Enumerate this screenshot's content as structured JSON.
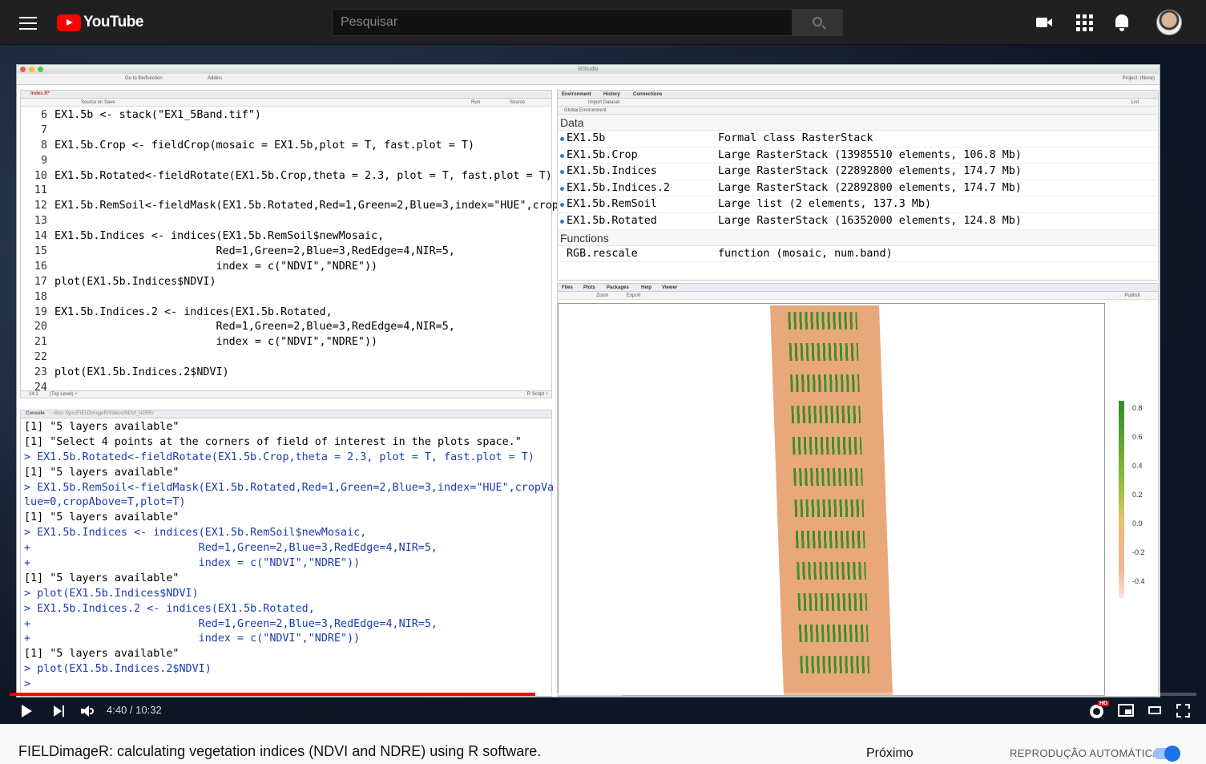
{
  "header": {
    "logo_text": "YouTube",
    "search_placeholder": "Pesquisar"
  },
  "rstudio": {
    "window_title": "RStudio",
    "toolbar": {
      "goto": "Go to file/function",
      "addins": "Addins",
      "project": "Project: (None)"
    },
    "editor": {
      "tab": "Index.R*",
      "source_on_save": "Source on Save",
      "run": "Run",
      "source": "Source",
      "lines": [
        {
          "n": "6",
          "code": "EX1.5b <- stack(\"EX1_5Band.tif\")"
        },
        {
          "n": "7",
          "code": ""
        },
        {
          "n": "8",
          "code": "EX1.5b.Crop <- fieldCrop(mosaic = EX1.5b,plot = T, fast.plot = T)"
        },
        {
          "n": "9",
          "code": ""
        },
        {
          "n": "10",
          "code": "EX1.5b.Rotated<-fieldRotate(EX1.5b.Crop,theta = 2.3, plot = T, fast.plot = T)"
        },
        {
          "n": "11",
          "code": ""
        },
        {
          "n": "12",
          "code": "EX1.5b.RemSoil<-fieldMask(EX1.5b.Rotated,Red=1,Green=2,Blue=3,index=\"HUE\",crop"
        },
        {
          "n": "13",
          "code": ""
        },
        {
          "n": "14",
          "code": "EX1.5b.Indices <- indices(EX1.5b.RemSoil$newMosaic,"
        },
        {
          "n": "15",
          "code": "                         Red=1,Green=2,Blue=3,RedEdge=4,NIR=5,"
        },
        {
          "n": "16",
          "code": "                         index = c(\"NDVI\",\"NDRE\"))"
        },
        {
          "n": "17",
          "code": "plot(EX1.5b.Indices$NDVI)"
        },
        {
          "n": "18",
          "code": ""
        },
        {
          "n": "19",
          "code": "EX1.5b.Indices.2 <- indices(EX1.5b.Rotated,"
        },
        {
          "n": "20",
          "code": "                         Red=1,Green=2,Blue=3,RedEdge=4,NIR=5,"
        },
        {
          "n": "21",
          "code": "                         index = c(\"NDVI\",\"NDRE\"))"
        },
        {
          "n": "22",
          "code": ""
        },
        {
          "n": "23",
          "code": "plot(EX1.5b.Indices.2$NDVI)"
        },
        {
          "n": "24",
          "code": ""
        }
      ],
      "status_pos": "24:1",
      "status_level": "(Top Level) ÷",
      "status_type": "R Script ÷"
    },
    "console": {
      "tab": "Console",
      "path": "~/Box Sync/FIELDimageR/Videos/NDVI_NDRE/",
      "lines": [
        {
          "t": "[1] \"5 layers available\"",
          "cmd": false
        },
        {
          "t": "[1] \"Select 4 points at the corners of field of interest in the plots space.\"",
          "cmd": false
        },
        {
          "t": "> EX1.5b.Rotated<-fieldRotate(EX1.5b.Crop,theta = 2.3, plot = T, fast.plot = T)",
          "cmd": true
        },
        {
          "t": "[1] \"5 layers available\"",
          "cmd": false
        },
        {
          "t": "> EX1.5b.RemSoil<-fieldMask(EX1.5b.Rotated,Red=1,Green=2,Blue=3,index=\"HUE\",cropVa",
          "cmd": true
        },
        {
          "t": "lue=0,cropAbove=T,plot=T)",
          "cmd": true
        },
        {
          "t": "[1] \"5 layers available\"",
          "cmd": false
        },
        {
          "t": "> EX1.5b.Indices <- indices(EX1.5b.RemSoil$newMosaic,",
          "cmd": true
        },
        {
          "t": "+                          Red=1,Green=2,Blue=3,RedEdge=4,NIR=5,",
          "cmd": true
        },
        {
          "t": "+                          index = c(\"NDVI\",\"NDRE\"))",
          "cmd": true
        },
        {
          "t": "[1] \"5 layers available\"",
          "cmd": false
        },
        {
          "t": "> plot(EX1.5b.Indices$NDVI)",
          "cmd": true
        },
        {
          "t": "> EX1.5b.Indices.2 <- indices(EX1.5b.Rotated,",
          "cmd": true
        },
        {
          "t": "+                          Red=1,Green=2,Blue=3,RedEdge=4,NIR=5,",
          "cmd": true
        },
        {
          "t": "+                          index = c(\"NDVI\",\"NDRE\"))",
          "cmd": true
        },
        {
          "t": "[1] \"5 layers available\"",
          "cmd": false
        },
        {
          "t": "> plot(EX1.5b.Indices.2$NDVI)",
          "cmd": true
        },
        {
          "t": ">",
          "cmd": true
        }
      ]
    },
    "environment": {
      "tabs": [
        "Environment",
        "History",
        "Connections"
      ],
      "import": "Import Dataset",
      "scope": "Global Environment",
      "list_mode": "List",
      "data_heading": "Data",
      "data": [
        {
          "name": "EX1.5b",
          "value": "Formal class RasterStack"
        },
        {
          "name": "EX1.5b.Crop",
          "value": "Large RasterStack (13985510 elements, 106.8 Mb)"
        },
        {
          "name": "EX1.5b.Indices",
          "value": "Large RasterStack (22892800 elements, 174.7 Mb)"
        },
        {
          "name": "EX1.5b.Indices.2",
          "value": "Large RasterStack (22892800 elements, 174.7 Mb)"
        },
        {
          "name": "EX1.5b.RemSoil",
          "value": "Large list (2 elements, 137.3 Mb)"
        },
        {
          "name": "EX1.5b.Rotated",
          "value": "Large RasterStack (16352000 elements, 124.8 Mb)"
        }
      ],
      "functions_heading": "Functions",
      "functions": [
        {
          "name": "RGB.rescale",
          "value": "function (mosaic, num.band)"
        }
      ]
    },
    "plots": {
      "tabs": [
        "Files",
        "Plots",
        "Packages",
        "Help",
        "Viewer"
      ],
      "zoom": "Zoom",
      "export": "Export",
      "publish": "Publish",
      "legend_ticks": [
        "0.8",
        "0.6",
        "0.4",
        "0.2",
        "0.0",
        "-0.2",
        "-0.4"
      ]
    }
  },
  "player": {
    "current_time": "4:40",
    "duration": "10:32",
    "time_display": "4:40 / 10:32",
    "progress_fraction": 0.443,
    "hd_badge": "HD"
  },
  "video": {
    "title": "FIELDimageR: calculating vegetation indices (NDVI and NDRE) using R software.",
    "next_label": "Próximo",
    "autoplay_label": "REPRODUÇÃO AUTOMÁTICA",
    "autoplay_on": true
  }
}
